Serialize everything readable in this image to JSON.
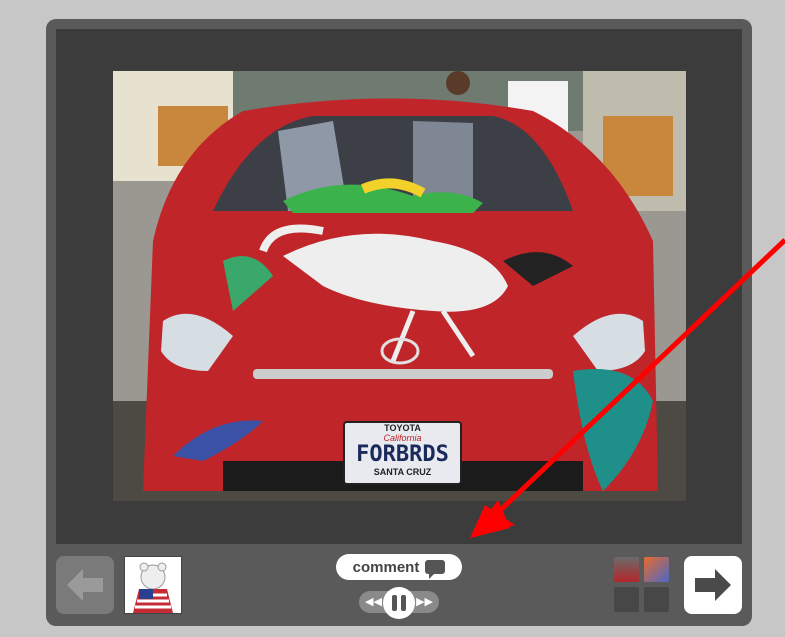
{
  "viewer": {
    "comment_label": "comment",
    "prev_icon": "arrow-left-icon",
    "next_icon": "arrow-right-icon",
    "pause_icon": "pause-icon",
    "rewind_icon": "rewind-icon",
    "forward_icon": "fast-forward-icon",
    "comment_icon": "speech-bubble-icon"
  },
  "photo": {
    "plate_top": "TOYOTA",
    "plate_state": "California",
    "plate_main": "FORBRDS",
    "plate_bottom": "SANTA CRUZ"
  },
  "colors": {
    "car_red": "#c0252a",
    "annotation_arrow": "#ff0000",
    "frame_dark": "#3c3c3c",
    "frame_mid": "#5a5a5a"
  }
}
